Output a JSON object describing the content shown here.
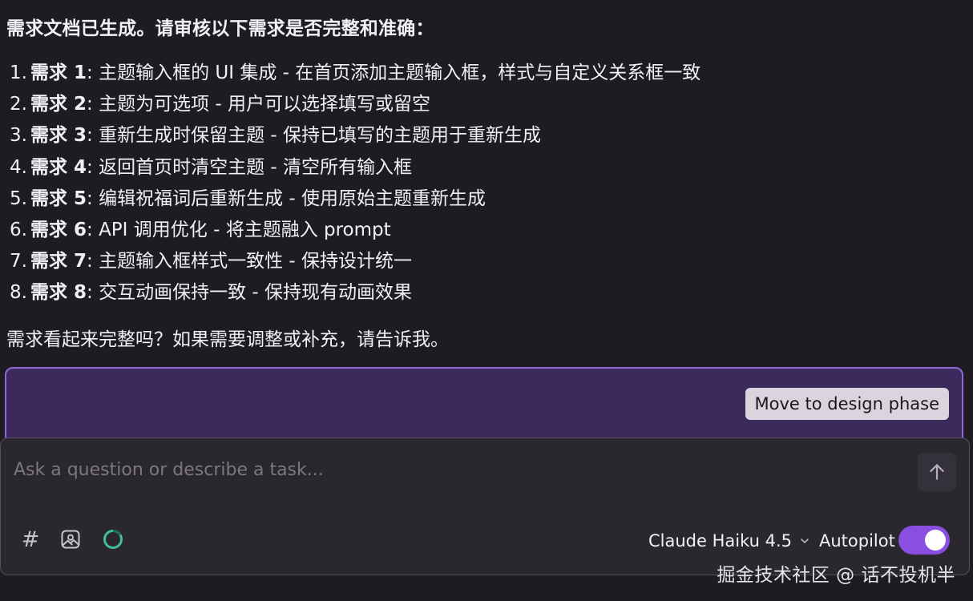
{
  "message": {
    "intro": "需求文档已生成。请审核以下需求是否完整和准确：",
    "requirements": [
      {
        "num": "1.",
        "name": "需求 1",
        "text": ": 主题输入框的 UI 集成 - 在首页添加主题输入框，样式与自定义关系框一致"
      },
      {
        "num": "2.",
        "name": "需求 2",
        "text": ": 主题为可选项 - 用户可以选择填写或留空"
      },
      {
        "num": "3.",
        "name": "需求 3",
        "text": ": 重新生成时保留主题 - 保持已填写的主题用于重新生成"
      },
      {
        "num": "4.",
        "name": "需求 4",
        "text": ": 返回首页时清空主题 - 清空所有输入框"
      },
      {
        "num": "5.",
        "name": "需求 5",
        "text": ": 编辑祝福词后重新生成 - 使用原始主题重新生成"
      },
      {
        "num": "6.",
        "name": "需求 6",
        "text": ": API 调用优化 - 将主题融入 prompt"
      },
      {
        "num": "7.",
        "name": "需求 7",
        "text": ": 主题输入框样式一致性 - 保持设计统一"
      },
      {
        "num": "8.",
        "name": "需求 8",
        "text": ": 交互动画保持一致 - 保持现有动画效果"
      }
    ],
    "closing": "需求看起来完整吗？如果需要调整或补充，请告诉我。"
  },
  "action": {
    "design_button": "Move to design phase"
  },
  "composer": {
    "placeholder": "Ask a question or describe a task...",
    "value": "",
    "hash_symbol": "#",
    "model": "Claude Haiku 4.5",
    "autopilot_label": "Autopilot",
    "autopilot_on": true
  },
  "watermark": "掘金技术社区 @ 话不投机半",
  "icons": {
    "send": "arrow-up-icon",
    "mention": "hash-icon",
    "image": "image-attach-icon",
    "status": "progress-ring-icon",
    "dropdown": "chevron-down-icon"
  },
  "colors": {
    "background": "#1e1b22",
    "design_box_bg": "#3d2a5c",
    "design_box_border": "#8e6ad6",
    "toggle_on": "#8a4ee0",
    "status_ring": "#3fbf9b"
  }
}
